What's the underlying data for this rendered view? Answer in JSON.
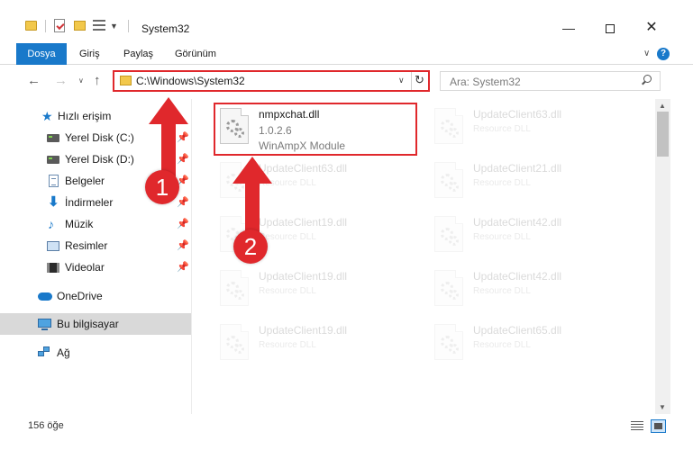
{
  "window": {
    "title": "System32",
    "controls": {
      "minimize": "—",
      "close": "✕"
    }
  },
  "ribbon": {
    "tabs": [
      "Dosya",
      "Giriş",
      "Paylaş",
      "Görünüm"
    ],
    "active_tab": "Dosya",
    "help": "?"
  },
  "address_bar": {
    "path": "C:\\Windows\\System32",
    "search_placeholder": "Ara: System32"
  },
  "nav_pane": {
    "items": [
      {
        "label": "Hızlı erişim",
        "icon": "star-icon",
        "pinned": false
      },
      {
        "label": "Yerel Disk (C:)",
        "icon": "drive-icon",
        "pinned": true
      },
      {
        "label": "Yerel Disk (D:)",
        "icon": "drive-icon",
        "pinned": true
      },
      {
        "label": "Belgeler",
        "icon": "documents-icon",
        "pinned": true
      },
      {
        "label": "İndirmeler",
        "icon": "downloads-icon",
        "pinned": true
      },
      {
        "label": "Müzik",
        "icon": "music-icon",
        "pinned": true
      },
      {
        "label": "Resimler",
        "icon": "pictures-icon",
        "pinned": true
      },
      {
        "label": "Videolar",
        "icon": "videos-icon",
        "pinned": true
      },
      {
        "label": "OneDrive",
        "icon": "onedrive-icon",
        "pinned": false
      },
      {
        "label": "Bu bilgisayar",
        "icon": "this-pc-icon",
        "pinned": false,
        "selected": true
      },
      {
        "label": "Ağ",
        "icon": "network-icon",
        "pinned": false
      }
    ]
  },
  "files": [
    {
      "name": "nmpxchat.dll",
      "version": "1.0.2.6",
      "description": "WinAmpX Module",
      "highlighted": true
    },
    {
      "name": "UpdateClient63.dll",
      "type": "Resource DLL"
    },
    {
      "name": "UpdateClient63.dll",
      "type": "Resource DLL"
    },
    {
      "name": "UpdateClient21.dll",
      "type": "Resource DLL"
    },
    {
      "name": "UpdateClient19.dll",
      "type": "Resource DLL"
    },
    {
      "name": "UpdateClient42.dll",
      "type": "Resource DLL"
    },
    {
      "name": "UpdateClient19.dll",
      "type": "Resource DLL"
    },
    {
      "name": "UpdateClient42.dll",
      "type": "Resource DLL"
    },
    {
      "name": "UpdateClient19.dll",
      "type": "Resource DLL"
    },
    {
      "name": "UpdateClient65.dll",
      "type": "Resource DLL"
    }
  ],
  "status": {
    "item_count": "156 öğe"
  },
  "annotations": {
    "step1": "1",
    "step2": "2",
    "color": "#e0282c"
  },
  "colors": {
    "accent": "#1979ca",
    "highlight": "#e0282c",
    "folder": "#f2c84b"
  }
}
